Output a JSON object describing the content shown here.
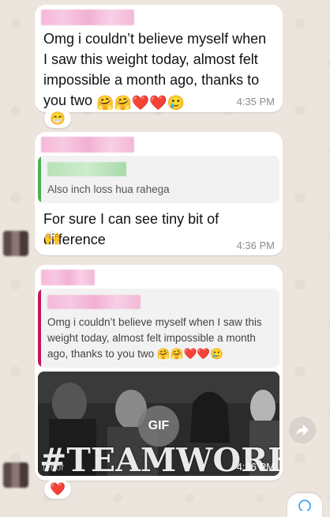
{
  "messages": [
    {
      "text": "Omg i couldn’t believe myself when I saw this weight today, almost felt impossible a month ago, thanks to you two",
      "emojis": "🤗🤗❤️❤️🥲",
      "time": "4:35 PM",
      "reaction": "😁"
    },
    {
      "quote_text": "Also inch loss hua rahega",
      "text": "For sure I can see tiny bit of difference",
      "emojis": "🙌",
      "time": "4:36 PM"
    },
    {
      "quote_text": "Omg i couldn’t believe myself when I saw this weight today, almost felt impossible a month ago, thanks to you two",
      "quote_emojis": "🤗🤗❤️❤️🥲",
      "gif_badge": "GIF",
      "gif_caption": "#TEAMWORK",
      "gif_source": "tenor",
      "time": "4:36 PM",
      "reaction": "❤️"
    }
  ],
  "colors": {
    "quote_bar_green": "#4caf50",
    "quote_bar_pink": "#c2185b",
    "sender_blur_pink": "#f4b9d8",
    "quote_name_green": "#b7e2b8"
  },
  "icons": {
    "forward": "forward-arrow-icon",
    "scroll_down": "chevron-down-icon"
  }
}
